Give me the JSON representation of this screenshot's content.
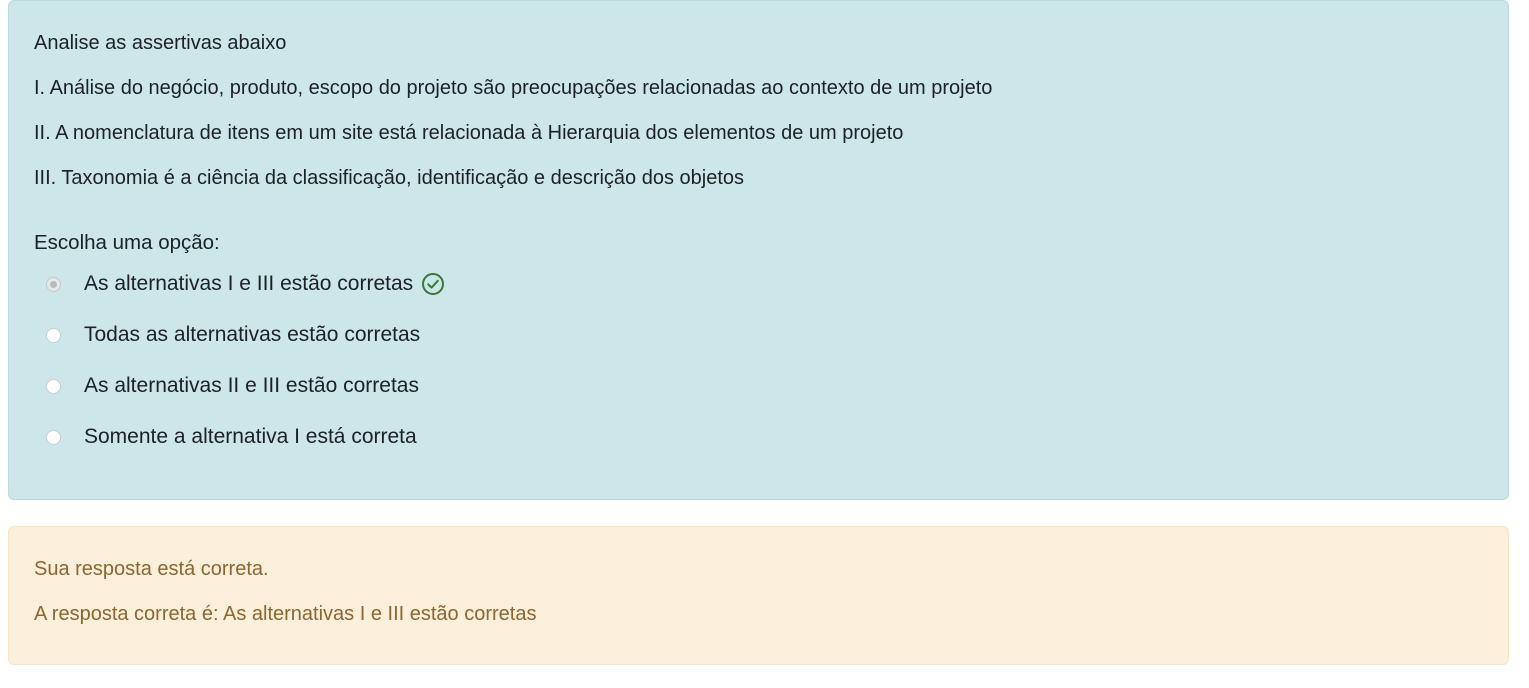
{
  "question": {
    "lines": [
      "Analise as assertivas abaixo",
      "I. Análise do negócio, produto, escopo do projeto são preocupações relacionadas ao contexto de um projeto",
      "II. A nomenclatura de itens em um site está relacionada à Hierarquia dos elementos de um projeto",
      "III. Taxonomia é a ciência da classificação, identificação e descrição dos objetos"
    ],
    "prompt": "Escolha uma opção:",
    "options": [
      {
        "label": "As alternativas I e III estão corretas",
        "selected": true,
        "marked_correct": true,
        "icon": "check-circle-icon"
      },
      {
        "label": "Todas as alternativas estão corretas",
        "selected": false
      },
      {
        "label": "As alternativas II e III estão corretas",
        "selected": false
      },
      {
        "label": "Somente a alternativa I está correta",
        "selected": false
      }
    ]
  },
  "feedback": {
    "status": "Sua resposta está correta.",
    "right_answer": "A resposta correta é: As alternativas I e III estão corretas"
  },
  "colors": {
    "question_bg": "#cce6ea",
    "feedback_bg": "#fcefdc",
    "feedback_text": "#8e662e",
    "correct_icon": "#357a32"
  }
}
